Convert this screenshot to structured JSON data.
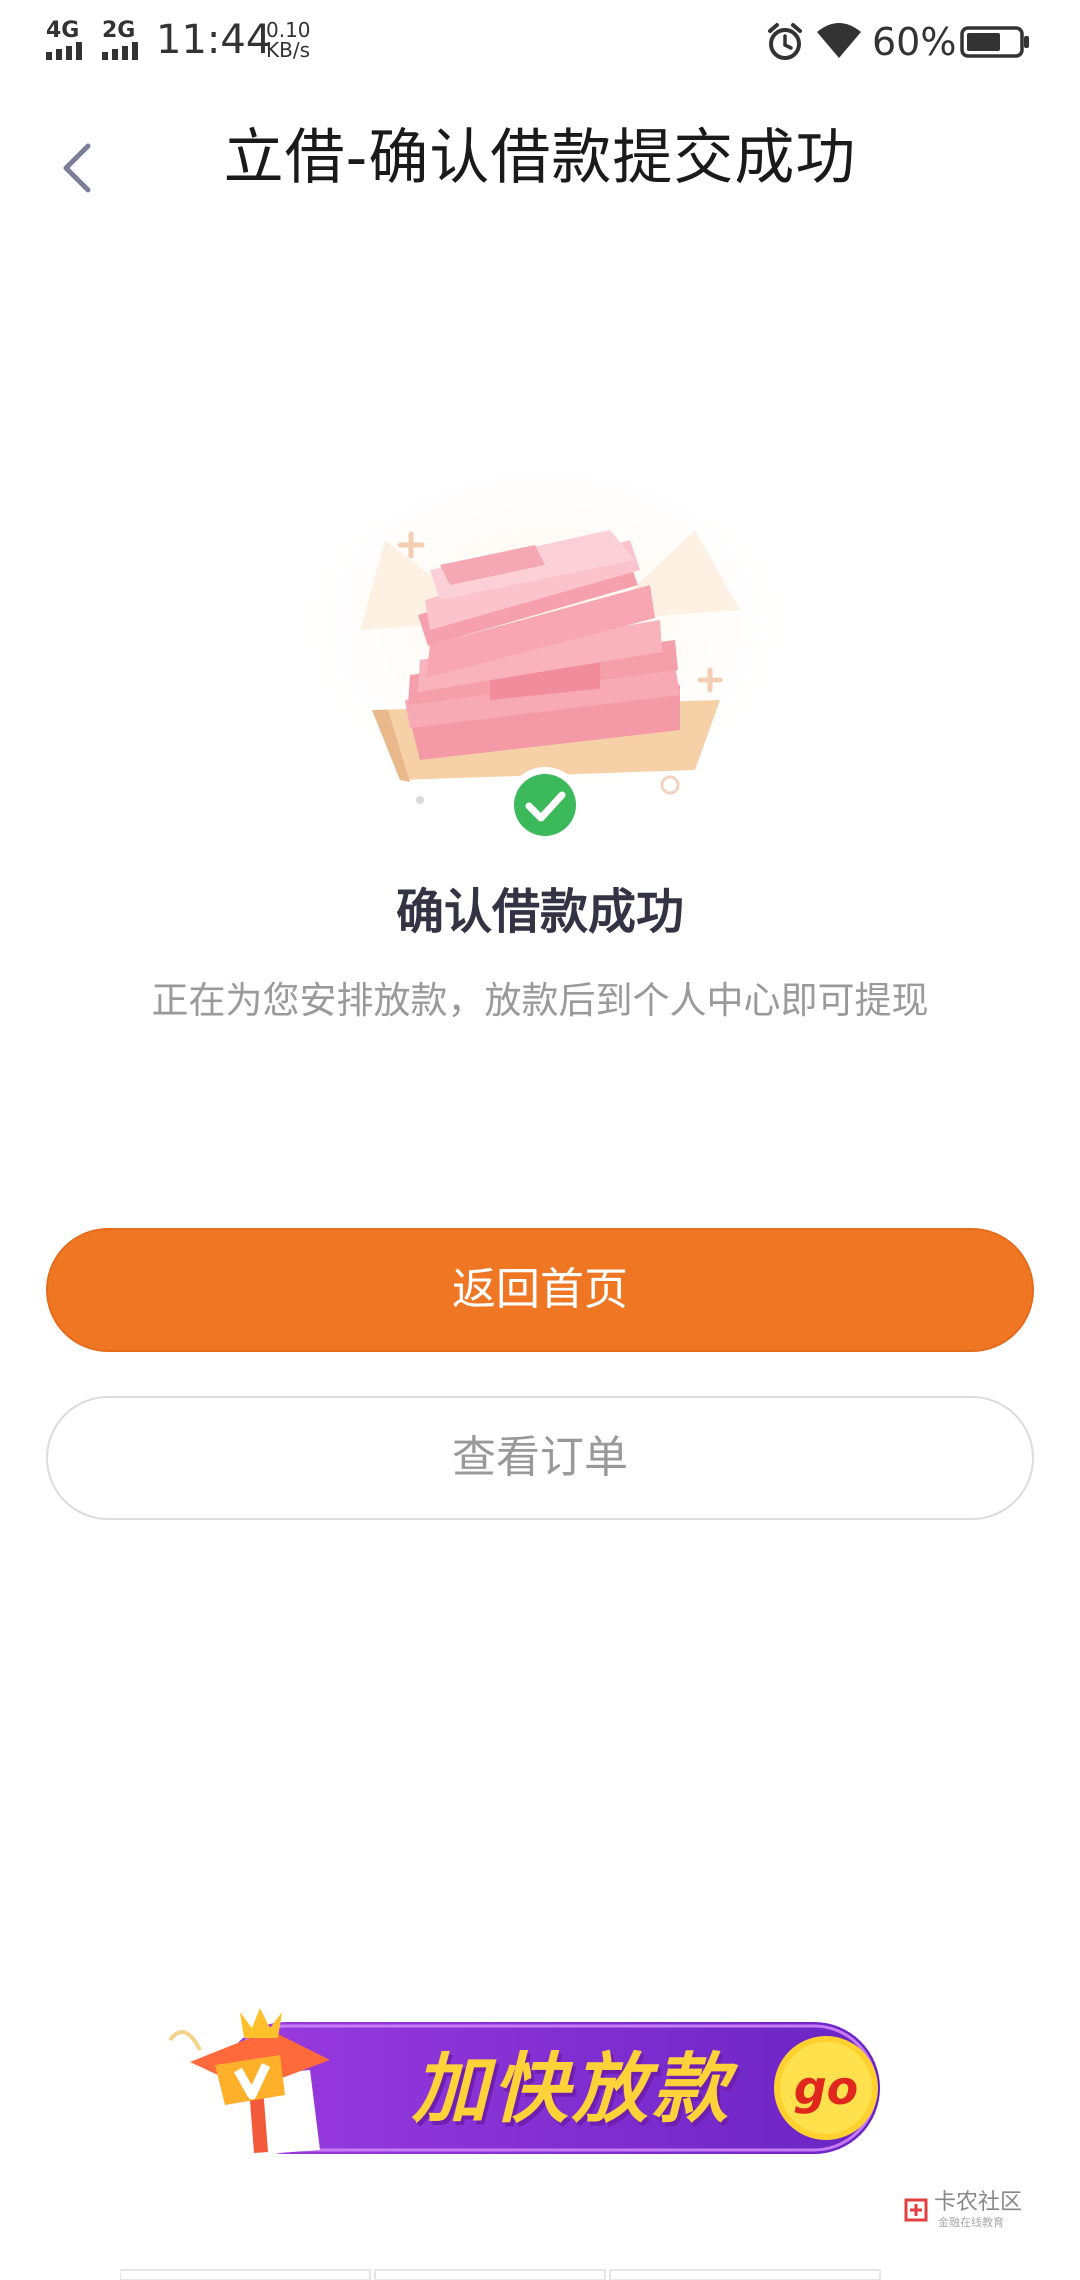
{
  "status_bar": {
    "network_1": "4G",
    "network_2": "2G",
    "time": "11:44",
    "speed_value": "0.10",
    "speed_unit": "KB/s",
    "battery_percent": "60%"
  },
  "header": {
    "title": "立借-确认借款提交成功"
  },
  "result": {
    "heading": "确认借款成功",
    "message": "正在为您安排放款，放款后到个人中心即可提现"
  },
  "actions": {
    "primary_label": "返回首页",
    "secondary_label": "查看订单"
  },
  "promo_banner": {
    "text": "加快放款",
    "go_label": "go"
  },
  "watermark": {
    "text": "卡农社区",
    "subtext": "金融在线教育"
  },
  "colors": {
    "accent": "#ef7623",
    "success": "#3cb95a",
    "banner_purple": "#7a2fd0",
    "banner_yellow": "#ffd23a"
  },
  "icons": {
    "back": "chevron-left-icon",
    "alarm": "alarm-icon",
    "wifi": "wifi-icon",
    "battery": "battery-icon",
    "success": "checkmark-icon"
  }
}
